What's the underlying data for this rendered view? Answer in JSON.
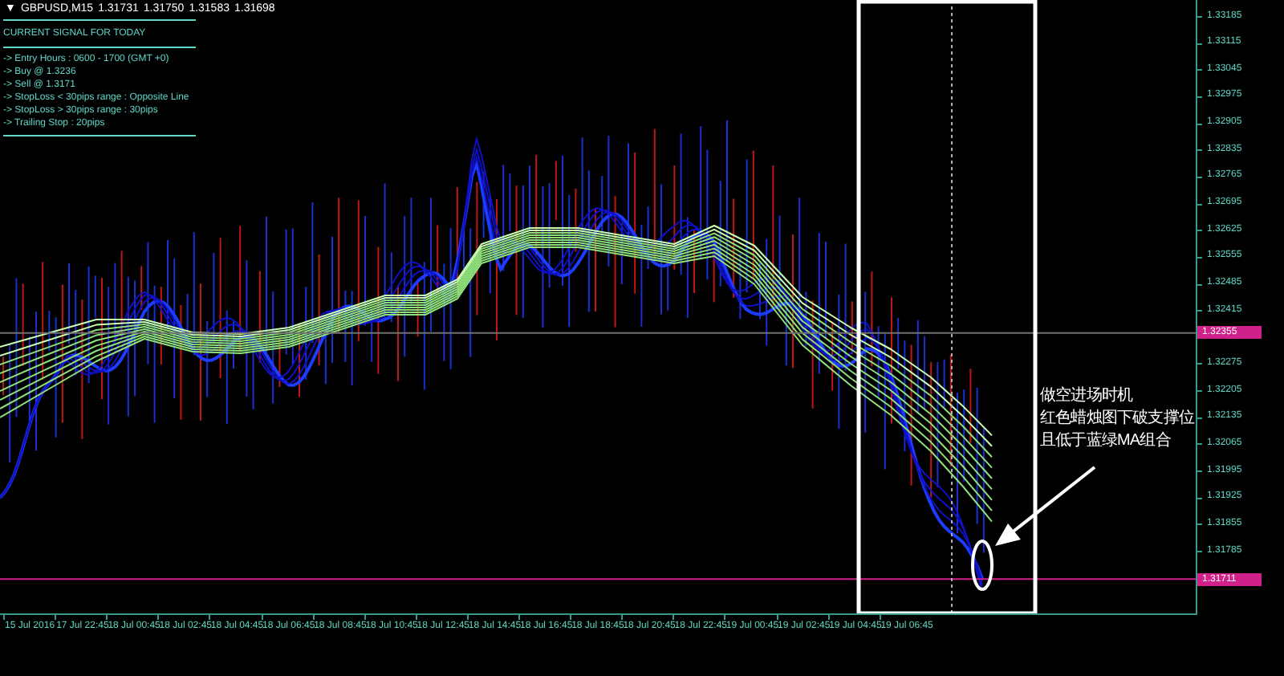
{
  "symbol_bar": {
    "collapse_glyph": "▼",
    "symbol": "GBPUSD,M15",
    "quotes": [
      "1.31731",
      "1.31750",
      "1.31583",
      "1.31698"
    ]
  },
  "signal_panel": {
    "title": "CURRENT SIGNAL FOR TODAY",
    "lines": [
      "-> Entry Hours : 0600 - 1700 (GMT +0)",
      "-> Buy @ 1.3236",
      "-> Sell @ 1.3171",
      "-> StopLoss < 30pips range : Opposite Line",
      "-> StopLoss > 30pips range : 30pips",
      "-> Trailing Stop : 20pips"
    ]
  },
  "price_axis": {
    "ticks": [
      "1.33185",
      "1.33115",
      "1.33045",
      "1.32975",
      "1.32905",
      "1.32835",
      "1.32765",
      "1.32695",
      "1.32625",
      "1.32555",
      "1.32485",
      "1.32415",
      "1.32275",
      "1.32205",
      "1.32135",
      "1.32065",
      "1.31995",
      "1.31925",
      "1.31855",
      "1.31785"
    ],
    "markers": [
      "1.32355",
      "1.31711"
    ]
  },
  "time_axis": {
    "labels": [
      "15 Jul 2016",
      "17 Jul 22:45",
      "18 Jul 00:45",
      "18 Jul 02:45",
      "18 Jul 04:45",
      "18 Jul 06:45",
      "18 Jul 08:45",
      "18 Jul 10:45",
      "18 Jul 12:45",
      "18 Jul 14:45",
      "18 Jul 16:45",
      "18 Jul 18:45",
      "18 Jul 20:45",
      "18 Jul 22:45",
      "19 Jul 00:45",
      "19 Jul 02:45",
      "19 Jul 04:45",
      "19 Jul 06:45"
    ]
  },
  "annotation": {
    "lines": [
      "做空进场时机",
      "红色蜡烛图下破支撑位",
      "且低于蓝绿MA组合"
    ]
  }
}
